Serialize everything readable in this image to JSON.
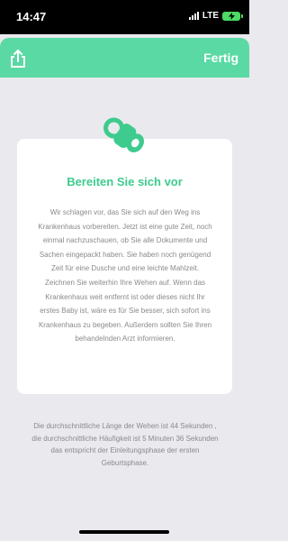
{
  "status_bar": {
    "time": "14:47",
    "network": "LTE",
    "battery_color": "#4cd964"
  },
  "header": {
    "share_icon": "share-icon",
    "done_label": "Fertig",
    "color": "#5ad9a4"
  },
  "card": {
    "icon": "pacifier-icon",
    "title": "Bereiten Sie sich vor",
    "body": "Wir schlagen vor, das Sie sich auf den Weg ins Krankenhaus vorbereiten. Jetzt ist eine gute Zeit, noch einmal nachzuschauen, ob Sie alle Dokumente und Sachen eingepackt haben. Sie haben noch genügend Zeit für eine Dusche und eine leichte Mahlzeit. Zeichnen Sie weiterhin Ihre Wehen auf. Wenn das Krankenhaus weit entfernt ist oder dieses nicht Ihr erstes Baby ist, wäre es für Sie besser, sich sofort ins Krankenhaus zu begeben. Außerdem sollten Sie Ihren behandelnden Arzt informieren."
  },
  "footer": {
    "text": "Die durchschnittliche Länge der Wehen ist 44 Sekunden , die durchschnittliche Häufigkeit ist 5 Minuten 36 Sekunden das entspricht der Einleitungsphase der ersten Geburtsphase."
  },
  "accent_color": "#3ecb8e"
}
